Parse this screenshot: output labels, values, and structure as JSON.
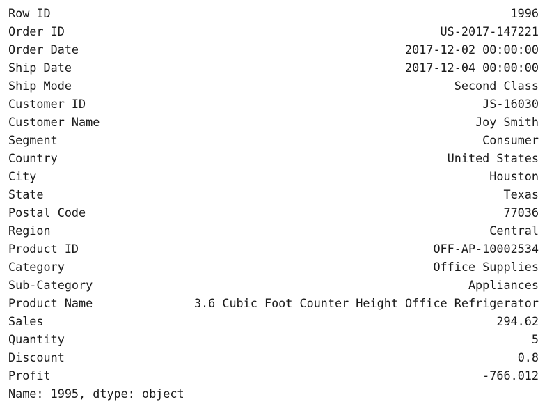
{
  "series": {
    "rows": [
      {
        "key": "Row ID",
        "value": "1996"
      },
      {
        "key": "Order ID",
        "value": "US-2017-147221"
      },
      {
        "key": "Order Date",
        "value": "2017-12-02 00:00:00"
      },
      {
        "key": "Ship Date",
        "value": "2017-12-04 00:00:00"
      },
      {
        "key": "Ship Mode",
        "value": "Second Class"
      },
      {
        "key": "Customer ID",
        "value": "JS-16030"
      },
      {
        "key": "Customer Name",
        "value": "Joy Smith"
      },
      {
        "key": "Segment",
        "value": "Consumer"
      },
      {
        "key": "Country",
        "value": "United States"
      },
      {
        "key": "City",
        "value": "Houston"
      },
      {
        "key": "State",
        "value": "Texas"
      },
      {
        "key": "Postal Code",
        "value": "77036"
      },
      {
        "key": "Region",
        "value": "Central"
      },
      {
        "key": "Product ID",
        "value": "OFF-AP-10002534"
      },
      {
        "key": "Category",
        "value": "Office Supplies"
      },
      {
        "key": "Sub-Category",
        "value": "Appliances"
      },
      {
        "key": "Product Name",
        "value": "3.6 Cubic Foot Counter Height Office Refrigerator"
      },
      {
        "key": "Sales",
        "value": "294.62"
      },
      {
        "key": "Quantity",
        "value": "5"
      },
      {
        "key": "Discount",
        "value": "0.8"
      },
      {
        "key": "Profit",
        "value": "-766.012"
      }
    ],
    "footer": "Name: 1995, dtype: object"
  }
}
